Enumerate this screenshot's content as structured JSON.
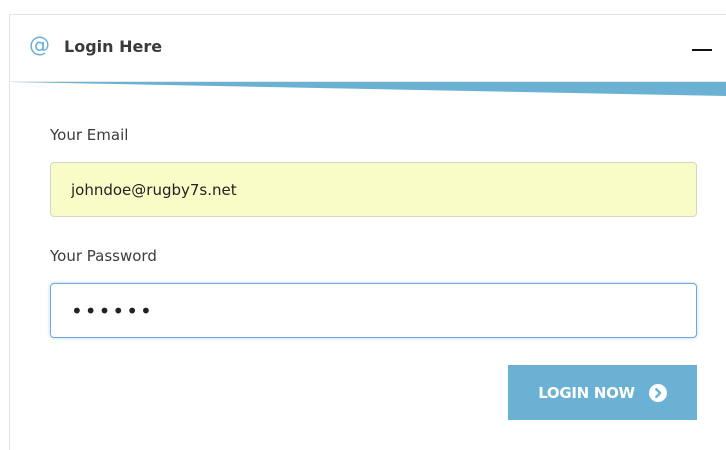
{
  "header": {
    "icon": "at-icon",
    "at_glyph": "@",
    "title": "Login Here",
    "collapse_icon": "minus-icon"
  },
  "form": {
    "email_label": "Your Email",
    "email_value": "johndoe@rugby7s.net",
    "password_label": "Your Password",
    "password_value": "••••••",
    "submit_label": "LOGIN NOW",
    "submit_icon": "arrow-circle-right-icon"
  },
  "colors": {
    "accent": "#6ab1d4",
    "autofill_bg": "#fafcc8",
    "focus_border": "#6fa9dc"
  }
}
